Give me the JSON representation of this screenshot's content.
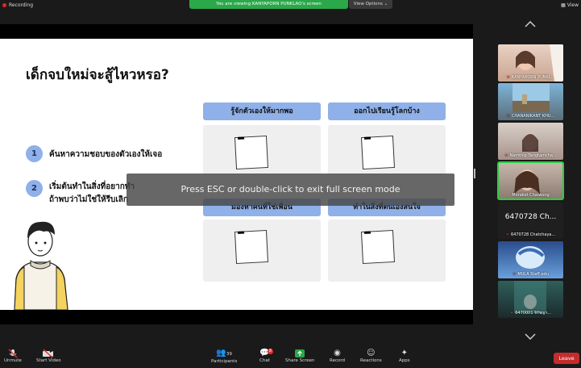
{
  "top_bar": {
    "recording": "Recording",
    "viewing_banner": "You are viewing KANYAPORN PUNKLAO's screen",
    "view_options": "View Options",
    "view": "View"
  },
  "slide": {
    "title": "เด็กจบใหม่จะสู้ไหวหรอ?",
    "items": [
      {
        "number": "1",
        "text": "ค้นหาความชอบของตัวเองให้เจอ"
      },
      {
        "number": "2",
        "line1": "เริ่มต้นทำในสิ่งที่อยากทำ",
        "line2": "ถ้าพบว่าไม่ใช่ให้รีบเลิก"
      }
    ],
    "cards": [
      {
        "header": "รู้จักตัวเองให้มากพอ"
      },
      {
        "header": "ออกไปเรียนรู้โลกบ้าง"
      },
      {
        "header": "มองหาคนที่ใช่เพื่อน"
      },
      {
        "header": "ทำในสิ่งที่ตนเองสนใจ"
      }
    ]
  },
  "overlay": {
    "text": "Press ESC or double-click to exit full screen mode"
  },
  "participants": [
    {
      "name": "KANYAPORN PUNKL..."
    },
    {
      "name": "CHANANIKANT KHU..."
    },
    {
      "name": "Namthip Tangtamcha..."
    },
    {
      "name": "Morakot Chaiwong"
    },
    {
      "big": "6470728 Ch...",
      "name": "6470728 Chatchaya..."
    },
    {
      "name": "MULA Staff.edu"
    },
    {
      "name": "6470001 จิรัชญา..."
    }
  ],
  "toolbar": {
    "unmute": "Unmute",
    "start_video": "Start Video",
    "participants": "Participants",
    "participant_count": "39",
    "chat": "Chat",
    "chat_badge": "8",
    "share_screen": "Share Screen",
    "record": "Record",
    "reactions": "Reactions",
    "apps": "Apps",
    "leave": "Leave"
  },
  "colors": {
    "viewing_banner": "#2aa84a",
    "accent_blue": "#8fb0e8",
    "leave": "#c62c2c",
    "active_speaker": "#2ecc40"
  }
}
